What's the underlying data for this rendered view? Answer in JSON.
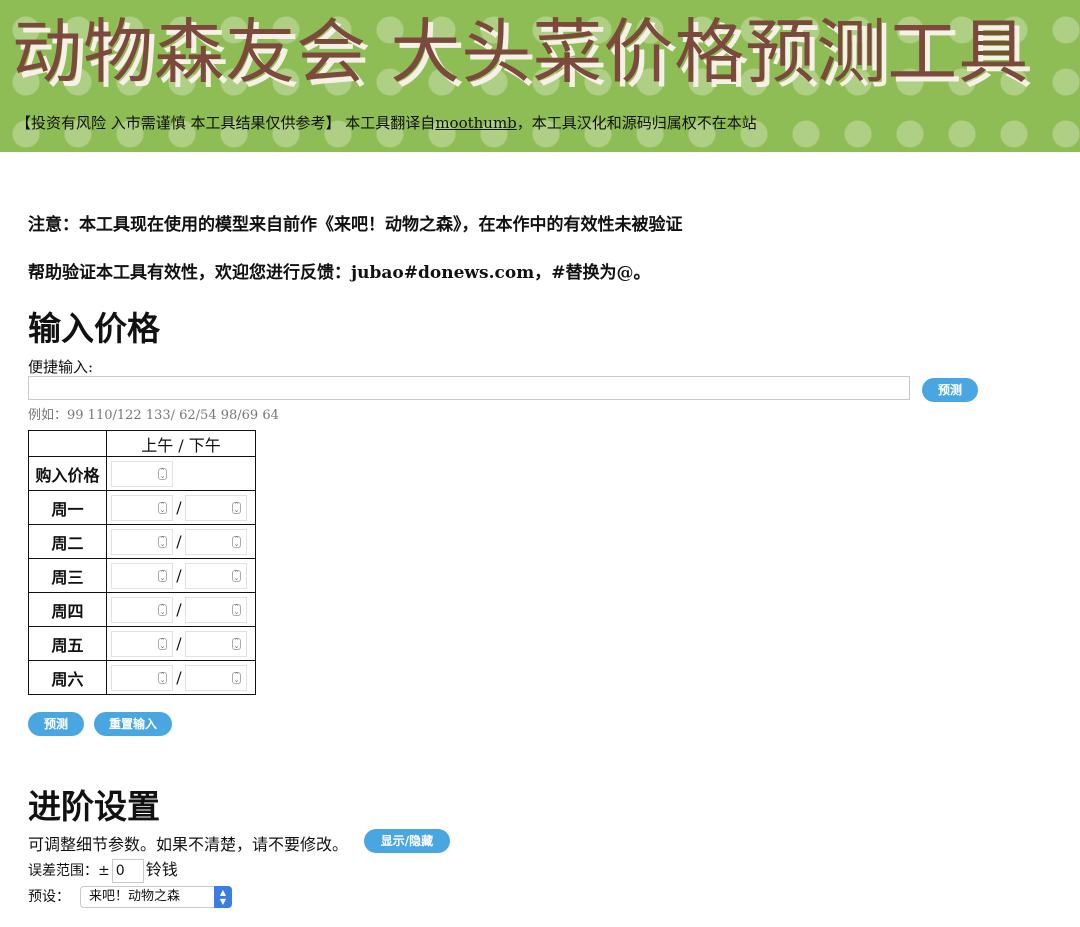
{
  "header": {
    "title": "动物森友会 大头菜价格预测工具",
    "disclaimer_prefix": "【投资有风险 入市需谨慎 本工具结果仅供参考】 本工具翻译自",
    "disclaimer_link": "moothumb",
    "disclaimer_suffix": "，本工具汉化和源码归属权不在本站"
  },
  "notices": {
    "line1": "注意：本工具现在使用的模型来自前作《来吧！动物之森》，在本作中的有效性未被验证",
    "line2": "帮助验证本工具有效性，欢迎您进行反馈：jubao#donews.com，#替换为@。"
  },
  "input_section": {
    "heading": "输入价格",
    "quick_label": "便捷输入:",
    "quick_value": "",
    "predict_label": "预测",
    "example": "例如：99 110/122 133/ 62/54 98/69 64"
  },
  "table": {
    "header": "上午 / 下午",
    "buy_label": "购入价格",
    "rows": [
      {
        "label": "周一"
      },
      {
        "label": "周二"
      },
      {
        "label": "周三"
      },
      {
        "label": "周四"
      },
      {
        "label": "周五"
      },
      {
        "label": "周六"
      }
    ],
    "separator": "/"
  },
  "actions": {
    "predict_label": "预测",
    "reset_label": "重置输入"
  },
  "advanced": {
    "heading": "进阶设置",
    "description": "可调整细节参数。如果不清楚，请不要修改。",
    "toggle_label": "显示/隐藏",
    "error_label": "误差范围：±",
    "error_value": "0",
    "error_unit": "铃钱",
    "preset_label": "预设：",
    "preset_value": "来吧！动物之森"
  },
  "colors": {
    "header_bg": "#8fbd55",
    "title_color": "#7b4a3c",
    "button_blue": "#4aa6e1",
    "select_blue": "#3b7de0"
  }
}
